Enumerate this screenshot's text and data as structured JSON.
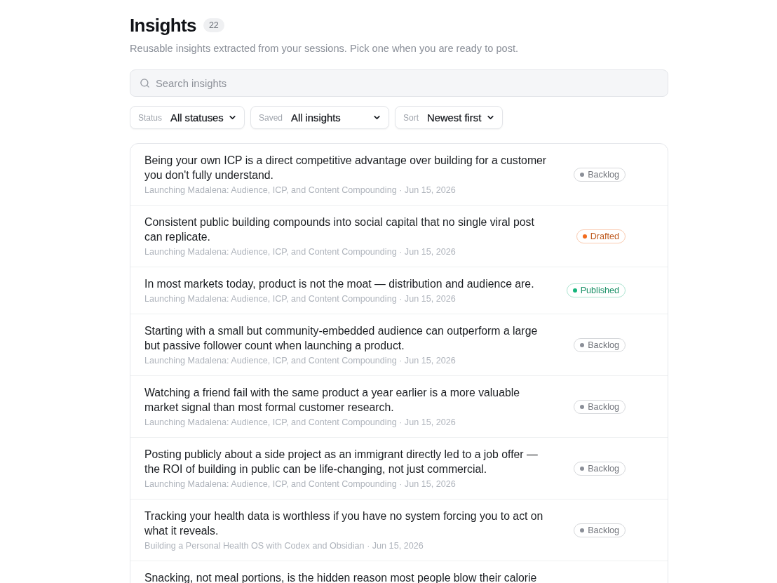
{
  "header": {
    "title": "Insights",
    "count": "22",
    "subtitle": "Reusable insights extracted from your sessions. Pick one when you are ready to post."
  },
  "search": {
    "placeholder": "Search insights"
  },
  "filters": [
    {
      "label": "Status",
      "value": "All statuses"
    },
    {
      "label": "Saved",
      "value": "All insights"
    },
    {
      "label": "Sort",
      "value": "Newest first"
    }
  ],
  "insights": [
    {
      "text": "Being your own ICP is a direct competitive advantage over building for a customer you don't fully understand.",
      "meta": "Launching Madalena: Audience, ICP, and Content Compounding · Jun 15, 2026",
      "status": {
        "label": "Backlog",
        "color": "#8b8f98"
      }
    },
    {
      "text": "Consistent public building compounds into social capital that no single viral post can replicate.",
      "meta": "Launching Madalena: Audience, ICP, and Content Compounding · Jun 15, 2026",
      "status": {
        "label": "Drafted",
        "color": "#f26b1d"
      }
    },
    {
      "text": "In most markets today, product is not the moat — distribution and audience are.",
      "meta": "Launching Madalena: Audience, ICP, and Content Compounding · Jun 15, 2026",
      "status": {
        "label": "Published",
        "color": "#16b57c"
      }
    },
    {
      "text": "Starting with a small but community-embedded audience can outperform a large but passive follower count when launching a product.",
      "meta": "Launching Madalena: Audience, ICP, and Content Compounding · Jun 15, 2026",
      "status": {
        "label": "Backlog",
        "color": "#8b8f98"
      }
    },
    {
      "text": "Watching a friend fail with the same product a year earlier is a more valuable market signal than most formal customer research.",
      "meta": "Launching Madalena: Audience, ICP, and Content Compounding · Jun 15, 2026",
      "status": {
        "label": "Backlog",
        "color": "#8b8f98"
      }
    },
    {
      "text": "Posting publicly about a side project as an immigrant directly led to a job offer — the ROI of building in public can be life-changing, not just commercial.",
      "meta": "Launching Madalena: Audience, ICP, and Content Compounding · Jun 15, 2026",
      "status": {
        "label": "Backlog",
        "color": "#8b8f98"
      }
    },
    {
      "text": "Tracking your health data is worthless if you have no system forcing you to act on what it reveals.",
      "meta": "Building a Personal Health OS with Codex and Obsidian · Jun 15, 2026",
      "status": {
        "label": "Backlog",
        "color": "#8b8f98"
      }
    },
    {
      "text": "Snacking, not meal portions, is the hidden reason most people blow their calorie"
    }
  ]
}
